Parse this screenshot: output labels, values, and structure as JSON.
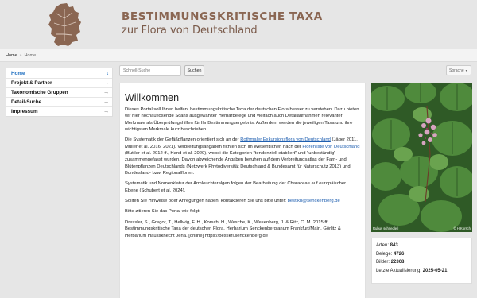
{
  "header": {
    "title": "BESTIMMUNGSKRITISCHE TAXA",
    "subtitle": "zur Flora von Deutschland"
  },
  "breadcrumb": {
    "items": [
      "Home",
      "Home"
    ],
    "separator": "»"
  },
  "sidebar": {
    "items": [
      {
        "label": "Home",
        "arrow": "↓"
      },
      {
        "label": "Projekt & Partner",
        "arrow": "→"
      },
      {
        "label": "Taxonomische Gruppen",
        "arrow": "→"
      },
      {
        "label": "Detail-Suche",
        "arrow": "→"
      },
      {
        "label": "Impressum",
        "arrow": "→"
      }
    ]
  },
  "search": {
    "placeholder": "Schnell-Suche",
    "button_label": "Suchen"
  },
  "language": {
    "label": "Sprache",
    "caret": "▾"
  },
  "main": {
    "heading": "Willkommen",
    "p1": "Dieses Portal soll Ihnen helfen, bestimmungskritische Taxa der deutschen Flora besser zu verstehen. Dazu bieten wir hier hochauflösende Scans ausgewählter Herbarbelege und vielfach auch Detailaufnahmen relevanter Merkmale als Überprüfungshilfen für Ihr Bestimmungsergebnis. Außerdem werden die jeweiligen Taxa und ihre wichtigsten Merkmale kurz beschrieben",
    "p2_a": "Die Systematik der Gefäßpflanzen orientiert sich an der ",
    "p2_link1": "Rothmaler Exkursionsflora von Deutschland",
    "p2_b": " (Jäger 2011, Müller et al. 2016, 2021). Verbreitungsangaben richten sich im Wesentlichen nach der ",
    "p2_link2": "Florenliste von Deutschland",
    "p2_c": " (Buttler et al. 2012 ff., Hand et al. 2020), wobei die Kategorien \"tendenziell etabliert\" und \"unbeständig\" zusammengefasst wurden. Davon abweichende Angaben beruhen auf dem Verbreitungsatlas der Farn- und Blütenpflanzen Deutschlands (Netzwerk Phytodiversität Deutschland & Bundesamt für Naturschutz 2013) und Bundesland- bzw. Regionalfloren.",
    "p3": "Systematik und Nomenklatur der Armleuchteralgen folgen der Bearbeitung der Characeae auf europäischer Ebene (Schubert et al. 2024).",
    "p4_a": "Sollten Sie Hinweise oder Anregungen haben, kontaktieren Sie uns bitte unter: ",
    "p4_link": "bestikri@senckenberg.de",
    "p5": "Bitte zitieren Sie das Portal wie folgt:",
    "p6": "Dressler, S., Gregor, T., Hellwig, F. H., Korsch, H., Wesche, K., Wesenberg, J. & Ritz, C. M. 2015 ff. Bestimmungskritische Taxa der deutschen Flora. Herbarium Senckenbergianum Frankfurt/Main, Görlitz & Herbarium Haussknecht Jena. [online] https://bestikri.senckenberg.de"
  },
  "photo": {
    "caption_left": "Rubus schnedleri",
    "caption_right": "© H.Korsch"
  },
  "stats": {
    "arten_label": "Arten:",
    "arten_value": "843",
    "belege_label": "Belege:",
    "belege_value": "4726",
    "bilder_label": "Bilder:",
    "bilder_value": "22368",
    "update_label": "Letzte Aktualisierung:",
    "update_value": "2025-05-21"
  },
  "colors": {
    "title": "#8a6652",
    "link": "#1f5fb0",
    "nav_active": "#1f6fc0",
    "leaf": "#3d7a2f"
  }
}
